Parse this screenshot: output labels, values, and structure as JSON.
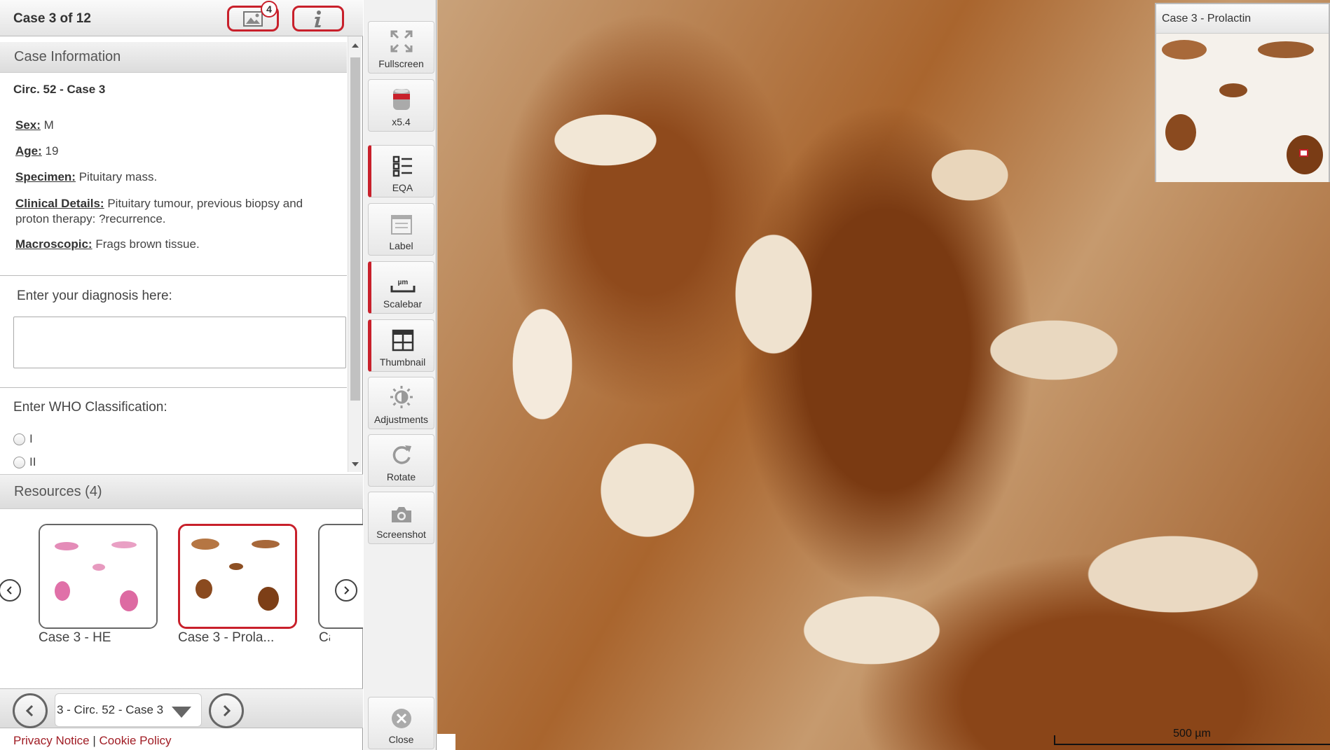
{
  "header": {
    "case_counter": "Case 3 of 12",
    "images_badge": "4"
  },
  "case_info": {
    "section_title": "Case Information",
    "case_title": "Circ. 52 - Case 3",
    "sex_label": "Sex:",
    "sex_value": "M",
    "age_label": "Age:",
    "age_value": "19",
    "specimen_label": "Specimen:",
    "specimen_value": "Pituitary mass.",
    "clinical_label": "Clinical Details:",
    "clinical_value": "Pituitary tumour, previous biopsy and proton therapy: ?recurrence.",
    "macro_label": "Macroscopic:",
    "macro_value": "Frags brown tissue.",
    "diagnosis_prompt": "Enter your diagnosis here:",
    "diagnosis_value": "",
    "who_prompt": "Enter WHO Classification:",
    "who_options": [
      "I",
      "II"
    ]
  },
  "resources": {
    "title": "Resources (4)",
    "items": [
      {
        "label": "Case 3 - HE",
        "selected": false
      },
      {
        "label": "Case 3 - Prola...",
        "selected": true
      },
      {
        "label": "Ca",
        "selected": false
      }
    ]
  },
  "bottom_nav": {
    "case_select_value": "3 - Circ. 52 - Case 3"
  },
  "footer": {
    "privacy": "Privacy Notice",
    "separator": "|",
    "cookie": "Cookie Policy"
  },
  "toolbar": {
    "fullscreen": "Fullscreen",
    "zoom": "x5.4",
    "eqa": "EQA",
    "label": "Label",
    "scalebar": "Scalebar",
    "scalebar_icon_text": "µm",
    "thumbnail": "Thumbnail",
    "adjustments": "Adjustments",
    "rotate": "Rotate",
    "screenshot": "Screenshot",
    "close": "Close"
  },
  "viewer": {
    "minimap_title": "Case 3 - Prolactin",
    "scale_label": "500 µm"
  },
  "colors": {
    "accent_red": "#c8202b",
    "link_red": "#a01c24",
    "stain_brown": "#8f4a1c"
  },
  "icons": {
    "images": "images-icon",
    "info": "info-icon",
    "fullscreen": "fullscreen-icon",
    "zoom": "objective-lens-icon",
    "eqa": "checklist-icon",
    "label": "label-icon",
    "scalebar": "ruler-icon",
    "thumbnail": "thumbnail-grid-icon",
    "adjustments": "brightness-icon",
    "rotate": "rotate-icon",
    "screenshot": "camera-icon",
    "close": "close-icon"
  }
}
